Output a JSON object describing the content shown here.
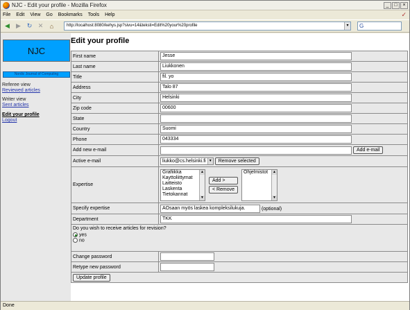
{
  "window": {
    "title": "NJC - Edit your profile - Mozilla Firefox",
    "minimize": "_",
    "maximize": "□",
    "close": "×"
  },
  "menu": {
    "items": [
      "File",
      "Edit",
      "View",
      "Go",
      "Bookmarks",
      "Tools",
      "Help"
    ]
  },
  "nav": {
    "url": "http://localhost:8080/kehys.jsp?sivu=14&teksti=Edit%20your%20profile",
    "search_value": "G"
  },
  "sidebar": {
    "logo": "NJC",
    "journal": "Nordic Journal of Computing",
    "referee_label": "Referee view",
    "reviewed_articles": "Reviewed articles",
    "writer_label": "Writer view",
    "sent_articles": "Sent articles",
    "edit_profile": "Edit your profile",
    "logout": "Logout"
  },
  "page": {
    "title": "Edit your profile"
  },
  "form": {
    "first_name_label": "First name",
    "first_name": "Jesse",
    "last_name_label": "Last name",
    "last_name": "Liukkonen",
    "title_label": "Title",
    "title": "fil. yo",
    "address_label": "Address",
    "address": "Talo 87",
    "city_label": "City",
    "city": "Helsinki",
    "zip_label": "Zip code",
    "zip": "00600",
    "state_label": "State",
    "state": "",
    "country_label": "Country",
    "country": "Suomi",
    "phone_label": "Phone",
    "phone": "043334",
    "add_email_label": "Add new e-mail",
    "add_email_value": "",
    "add_email_button": "Add e-mail",
    "active_email_label": "Active e-mail",
    "active_email": "liukko@cs.helsinki.fi",
    "remove_selected_button": "Remove selected",
    "expertise_label": "Expertise",
    "expertise_available": [
      "Grafiikka",
      "Kayttoliittymat",
      "Laitteisto",
      "Laskenta",
      "Tietokannat"
    ],
    "add_button": "Add >",
    "remove_button": "< Remove",
    "expertise_selected": [
      "Ohjelmistot"
    ],
    "specify_expertise_label": "Specify expertise",
    "specify_expertise": "AOsaan myös laskea kompleksilukuja.",
    "optional_note": "(optional)",
    "department_label": "Department",
    "department": "TKK",
    "revision_question": "Do you wish to receive articles for revision?",
    "revision_yes": "yes",
    "revision_no": "no",
    "revision_selected": "yes",
    "change_password_label": "Change password",
    "retype_password_label": "Retype new password",
    "update_button": "Update profile"
  },
  "status": {
    "text": "Done"
  }
}
